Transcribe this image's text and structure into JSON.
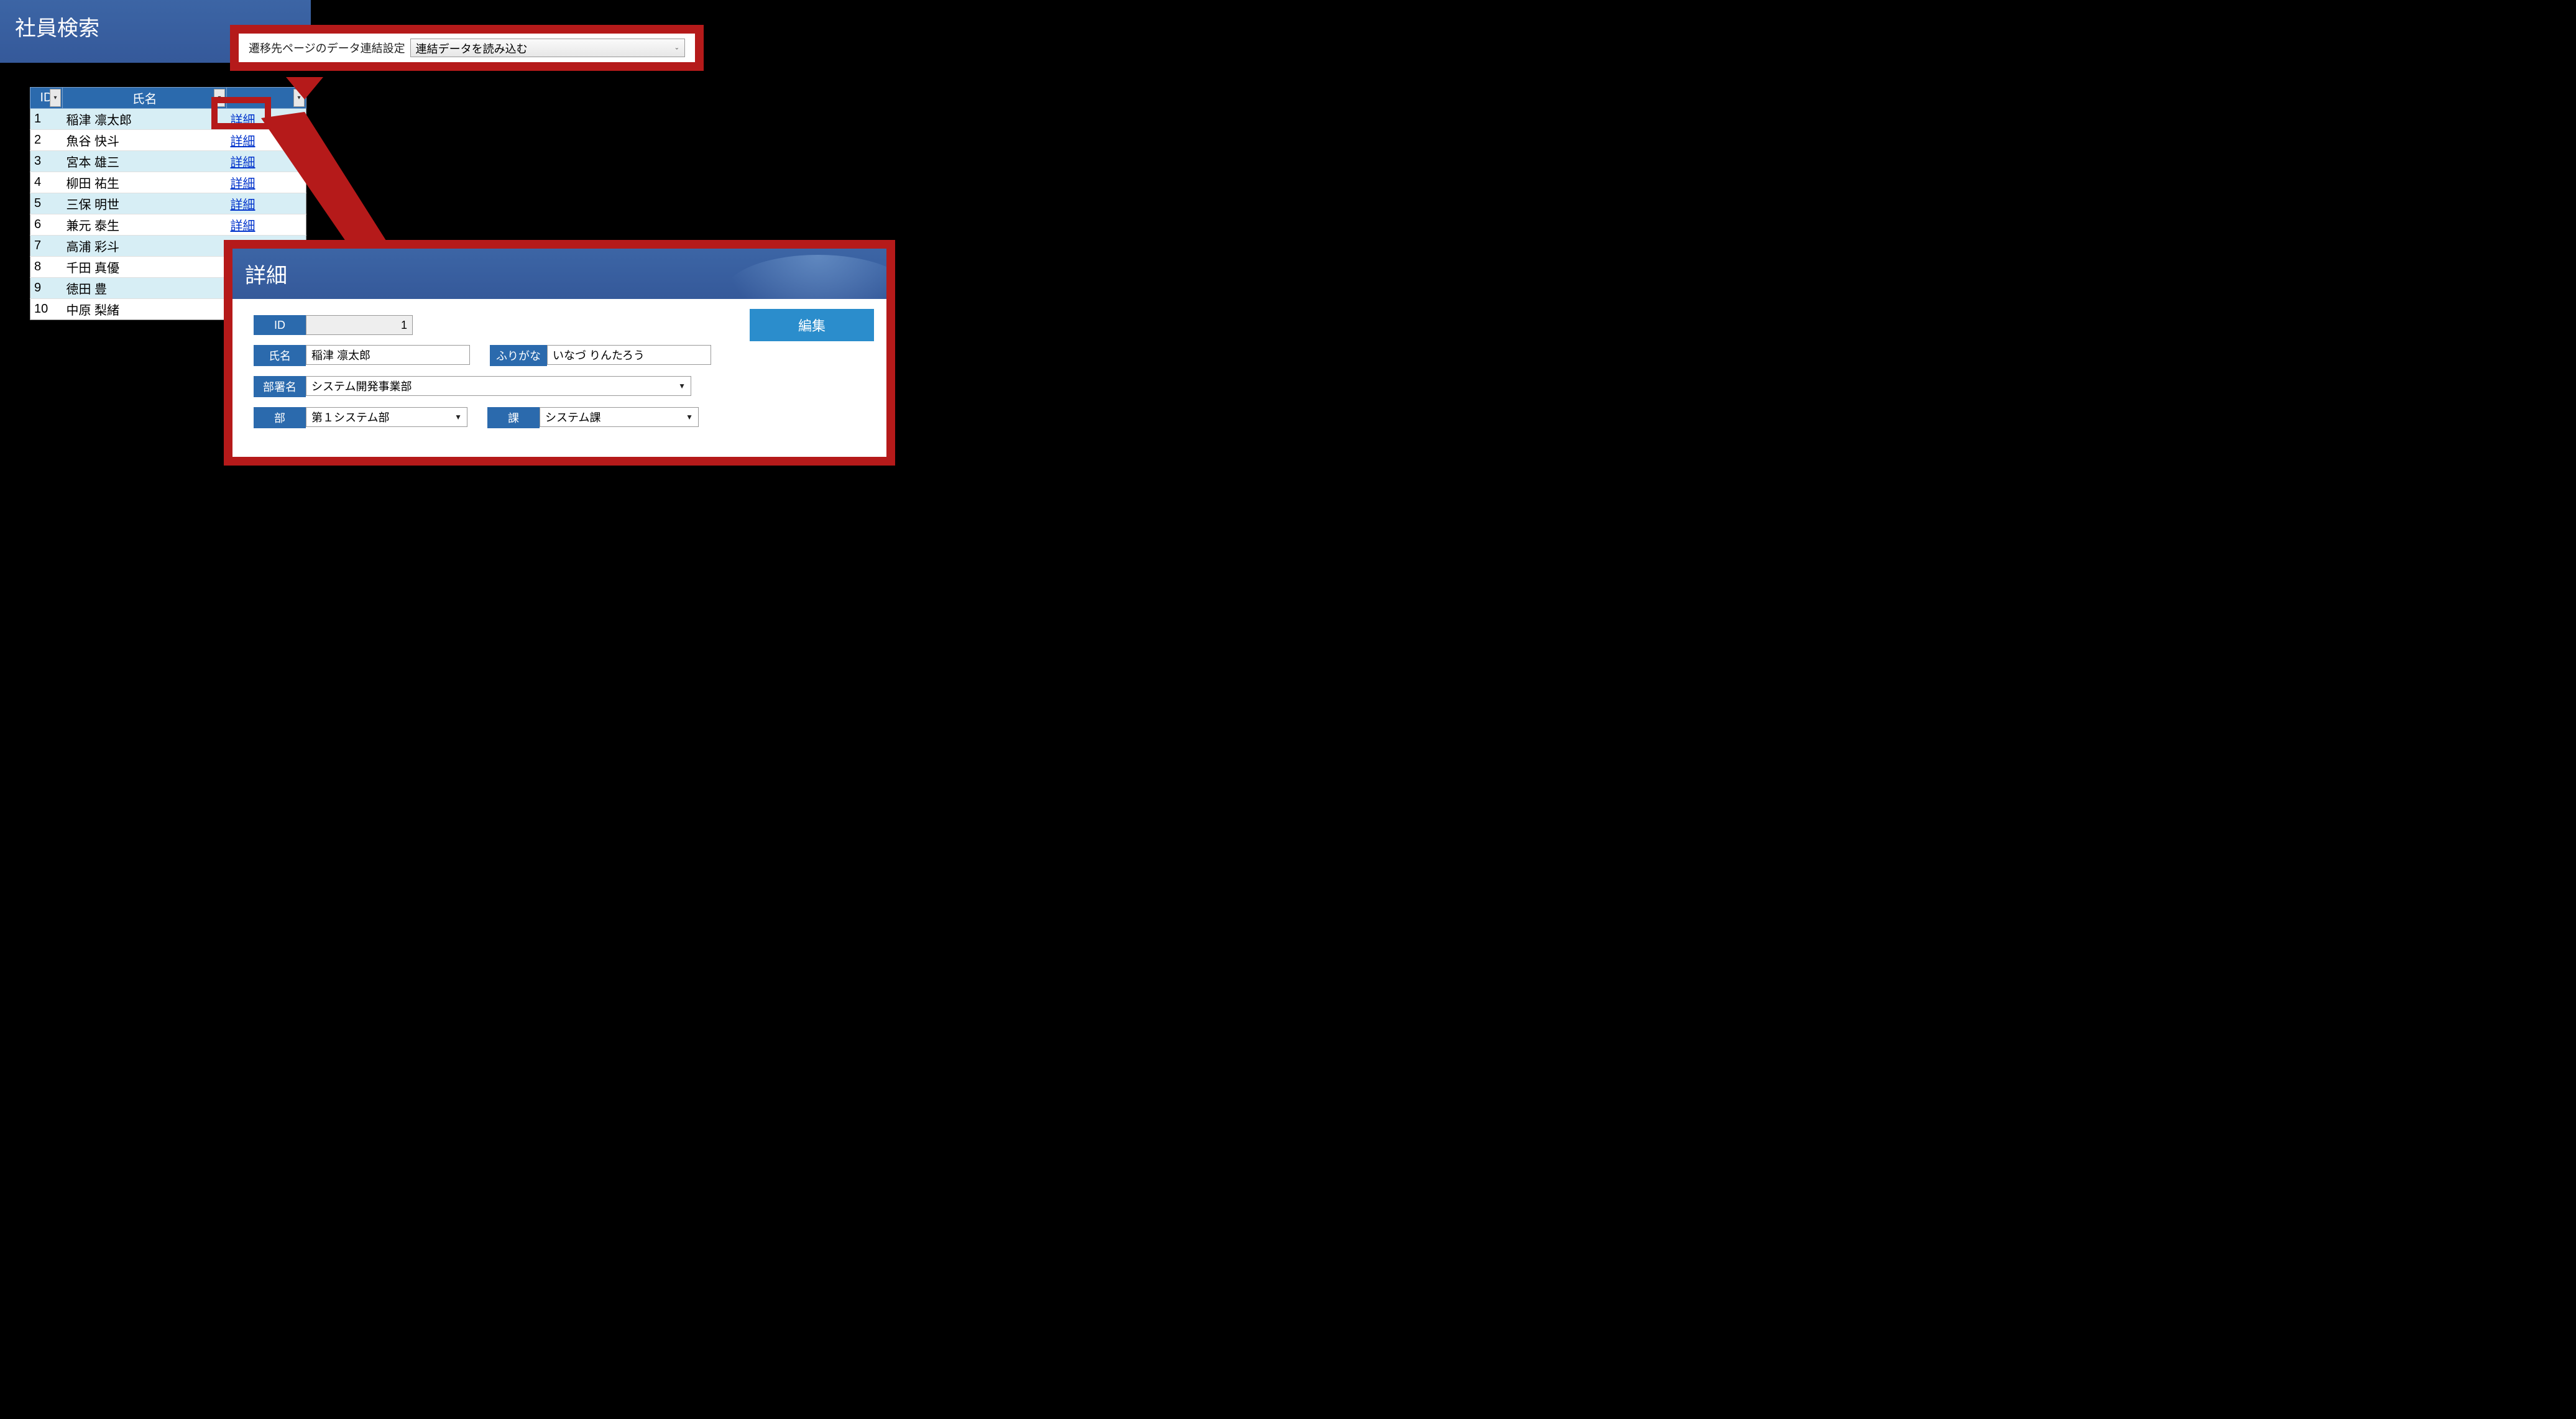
{
  "searchPanel": {
    "title": "社員検索",
    "columns": {
      "id": "ID",
      "name": "氏名",
      "action": ""
    },
    "link_label": "詳細",
    "rows": [
      {
        "id": "1",
        "name": "稲津  凛太郎"
      },
      {
        "id": "2",
        "name": "魚谷  快斗"
      },
      {
        "id": "3",
        "name": "宮本  雄三"
      },
      {
        "id": "4",
        "name": "柳田  祐生"
      },
      {
        "id": "5",
        "name": "三保  明世"
      },
      {
        "id": "6",
        "name": "兼元  泰生"
      },
      {
        "id": "7",
        "name": "高浦  彩斗"
      },
      {
        "id": "8",
        "name": "千田  真優"
      },
      {
        "id": "9",
        "name": "徳田  豊"
      },
      {
        "id": "10",
        "name": "中原  梨緒"
      }
    ]
  },
  "callout": {
    "label": "遷移先ページのデータ連結設定",
    "selected": "連結データを読み込む"
  },
  "detail": {
    "title": "詳細",
    "editButton": "編集",
    "fields": {
      "id": {
        "label": "ID",
        "value": "1"
      },
      "name": {
        "label": "氏名",
        "value": "稲津  凛太郎"
      },
      "furigana": {
        "label": "ふりがな",
        "value": "いなづ  りんたろう"
      },
      "busho": {
        "label": "部署名",
        "value": "システム開発事業部"
      },
      "bu": {
        "label": "部",
        "value": "第１システム部"
      },
      "ka": {
        "label": "課",
        "value": "システム課"
      }
    }
  },
  "colors": {
    "accent": "#b51a1a",
    "headerBlue": "#3c65a5",
    "labelBlue": "#2b6aad",
    "buttonBlue": "#2b8dcc"
  }
}
